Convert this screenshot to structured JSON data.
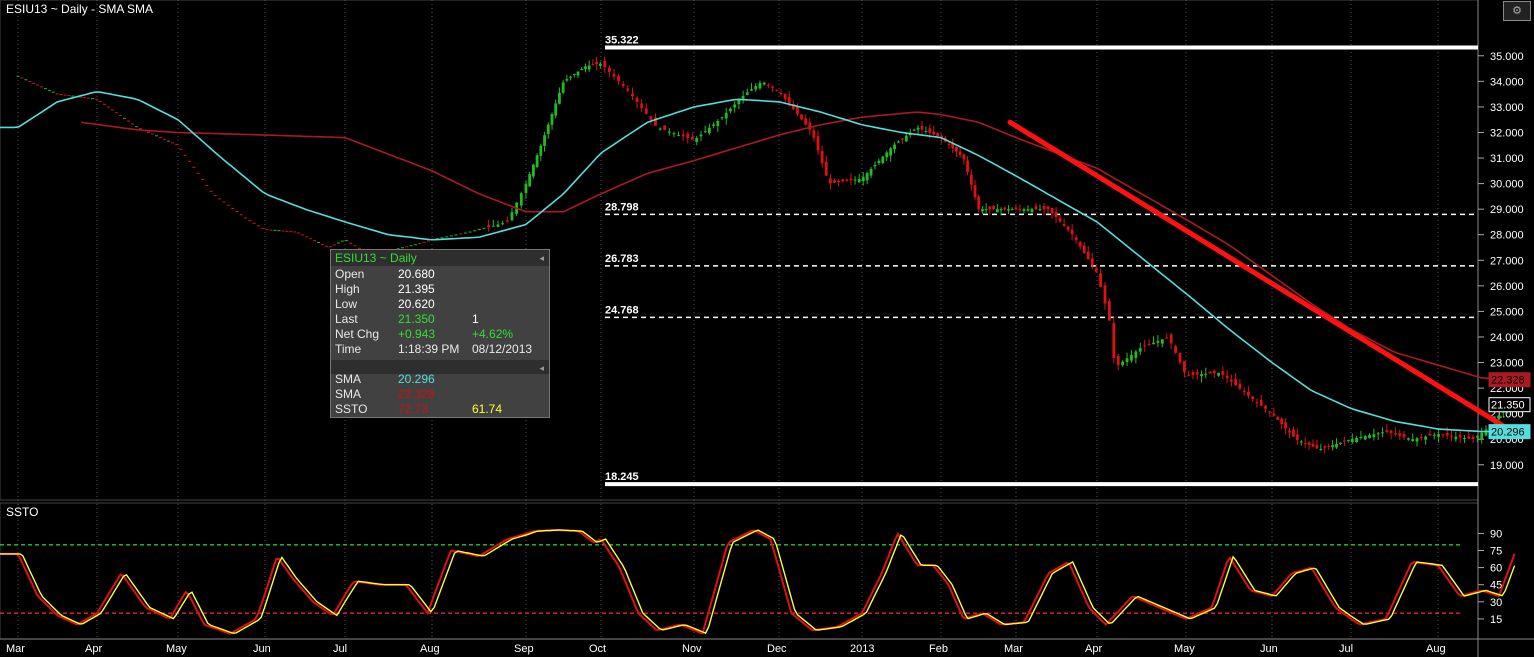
{
  "window": {
    "title": "ESIU13 ~ Daily  -  SMA SMA",
    "lower_panel_title": "SSTO",
    "settings_icon": "gear-icon"
  },
  "colors": {
    "background": "#000000",
    "up_candle": "#22bb22",
    "down_candle": "#dd1111",
    "sma_fast": "#55dddd",
    "sma_slow": "#aa1a22",
    "trendline": "#ff1111",
    "ssto_k": "#dd1111",
    "ssto_d": "#ffff33",
    "overbought_line": "#22cc22",
    "oversold_line": "#ee2222"
  },
  "info_box": {
    "title": "ESIU13 ~ Daily",
    "rows": [
      {
        "label": "Open",
        "value": "20.680",
        "value2": ""
      },
      {
        "label": "High",
        "value": "21.395",
        "value2": ""
      },
      {
        "label": "Low",
        "value": "20.620",
        "value2": ""
      },
      {
        "label": "Last",
        "value": "21.350",
        "value2": "1"
      },
      {
        "label": "Net Chg",
        "value": "+0.943",
        "value2": "+4.62%"
      },
      {
        "label": "Time",
        "value": "1:18:39 PM",
        "value2": "08/12/2013"
      }
    ],
    "indicators": [
      {
        "label": "SMA",
        "value": "20.296",
        "value2": ""
      },
      {
        "label": "SMA",
        "value": "22.328",
        "value2": ""
      },
      {
        "label": "SSTO",
        "value": "72.73",
        "value2": "61.74"
      }
    ]
  },
  "chart_data": [
    {
      "type": "candlestick",
      "title": "ESIU13 ~ Daily  -  SMA SMA",
      "x_tick_labels": [
        "Mar",
        "Apr",
        "May",
        "Jun",
        "Jul",
        "Aug",
        "Sep",
        "Oct",
        "Nov",
        "Dec",
        "2013",
        "Feb",
        "Mar",
        "Apr",
        "May",
        "Jun",
        "Jul",
        "Aug"
      ],
      "y_tick_labels": [
        "35.000",
        "34.000",
        "33.000",
        "32.000",
        "31.000",
        "30.000",
        "29.000",
        "28.000",
        "27.000",
        "26.000",
        "25.000",
        "24.000",
        "23.000",
        "22.000",
        "21.000",
        "20.000",
        "19.000"
      ],
      "ylim": [
        17.7,
        36.4
      ],
      "last_price": 21.35,
      "price_labels": [
        {
          "label": "21.350",
          "value": 21.35
        },
        {
          "label": "20.296",
          "value": 20.296
        },
        {
          "label": "22.328",
          "value": 22.328
        }
      ],
      "fib_levels": [
        {
          "label": "35.322",
          "value": 35.322,
          "style": "solid"
        },
        {
          "label": "28.798",
          "value": 28.798,
          "style": "dashed"
        },
        {
          "label": "26.783",
          "value": 26.783,
          "style": "dashed"
        },
        {
          "label": "24.768",
          "value": 24.768,
          "style": "dashed"
        },
        {
          "label": "18.245",
          "value": 18.245,
          "style": "solid"
        }
      ],
      "trendline": {
        "from_month": 11.92,
        "from_value": 32.4,
        "to_month": 17.88,
        "to_value": 20.25
      },
      "price_knots": [
        [
          0,
          34.2
        ],
        [
          0.5,
          33.5
        ],
        [
          1,
          33.3
        ],
        [
          1.5,
          32.2
        ],
        [
          2,
          31.5
        ],
        [
          2.4,
          29.6
        ],
        [
          2.8,
          28.6
        ],
        [
          3,
          28.2
        ],
        [
          3.4,
          28.1
        ],
        [
          3.8,
          27.5
        ],
        [
          4,
          27.8
        ],
        [
          4.3,
          27.2
        ],
        [
          4.8,
          27.6
        ],
        [
          5,
          27.8
        ],
        [
          5.4,
          28.1
        ],
        [
          5.8,
          28.5
        ],
        [
          6.2,
          31.5
        ],
        [
          6.5,
          34.0
        ],
        [
          6.8,
          34.6
        ],
        [
          7,
          34.7
        ],
        [
          7.3,
          33.6
        ],
        [
          7.6,
          32.2
        ],
        [
          8,
          31.7
        ],
        [
          8.3,
          32.5
        ],
        [
          8.6,
          33.5
        ],
        [
          8.8,
          34.0
        ],
        [
          9,
          33.6
        ],
        [
          9.4,
          32.0
        ],
        [
          9.6,
          30.0
        ],
        [
          10,
          30.2
        ],
        [
          10.4,
          31.5
        ],
        [
          10.7,
          32.2
        ],
        [
          11,
          31.8
        ],
        [
          11.3,
          31.0
        ],
        [
          11.5,
          29.0
        ],
        [
          11.9,
          29.0
        ],
        [
          12.4,
          29.0
        ],
        [
          12.7,
          28.0
        ],
        [
          13,
          26.5
        ],
        [
          13.15,
          24.5
        ],
        [
          13.2,
          22.8
        ],
        [
          13.5,
          23.6
        ],
        [
          13.8,
          24.0
        ],
        [
          14,
          22.5
        ],
        [
          14.4,
          22.6
        ],
        [
          14.8,
          21.5
        ],
        [
          15,
          21.0
        ],
        [
          15.3,
          20.0
        ],
        [
          15.6,
          19.6
        ],
        [
          16,
          20.0
        ],
        [
          16.4,
          20.3
        ],
        [
          16.7,
          20.0
        ],
        [
          17,
          20.2
        ],
        [
          17.4,
          20.0
        ],
        [
          17.6,
          20.5
        ],
        [
          17.8,
          21.35
        ]
      ],
      "sma_fast_knots": [
        [
          0,
          32.2
        ],
        [
          0.5,
          33.2
        ],
        [
          1,
          33.6
        ],
        [
          1.5,
          33.3
        ],
        [
          2,
          32.5
        ],
        [
          2.5,
          31.0
        ],
        [
          3,
          29.6
        ],
        [
          3.5,
          29.0
        ],
        [
          4,
          28.5
        ],
        [
          4.5,
          28.0
        ],
        [
          5,
          27.8
        ],
        [
          5.5,
          27.9
        ],
        [
          6,
          28.4
        ],
        [
          6.5,
          29.6
        ],
        [
          7,
          31.2
        ],
        [
          7.5,
          32.4
        ],
        [
          8,
          33.0
        ],
        [
          8.5,
          33.3
        ],
        [
          9,
          33.2
        ],
        [
          9.5,
          32.8
        ],
        [
          10,
          32.3
        ],
        [
          10.5,
          32.0
        ],
        [
          11,
          31.8
        ],
        [
          11.5,
          31.1
        ],
        [
          12,
          30.3
        ],
        [
          12.5,
          29.4
        ],
        [
          13,
          28.5
        ],
        [
          13.5,
          27.1
        ],
        [
          14,
          25.7
        ],
        [
          14.5,
          24.3
        ],
        [
          15,
          23.0
        ],
        [
          15.5,
          21.9
        ],
        [
          16,
          21.2
        ],
        [
          16.5,
          20.7
        ],
        [
          17,
          20.4
        ],
        [
          17.5,
          20.3
        ],
        [
          17.9,
          20.3
        ]
      ],
      "sma_slow_knots": [
        [
          0.8,
          32.4
        ],
        [
          1.5,
          32.1
        ],
        [
          2,
          32.0
        ],
        [
          3,
          31.9
        ],
        [
          4,
          31.8
        ],
        [
          5,
          30.5
        ],
        [
          5.5,
          29.6
        ],
        [
          6,
          28.9
        ],
        [
          6.5,
          28.9
        ],
        [
          7,
          29.6
        ],
        [
          7.5,
          30.4
        ],
        [
          8,
          30.9
        ],
        [
          8.5,
          31.4
        ],
        [
          9,
          31.9
        ],
        [
          9.5,
          32.3
        ],
        [
          10,
          32.6
        ],
        [
          10.7,
          32.8
        ],
        [
          11,
          32.7
        ],
        [
          11.5,
          32.4
        ],
        [
          12,
          31.8
        ],
        [
          12.5,
          31.2
        ],
        [
          13,
          30.6
        ],
        [
          13.5,
          29.6
        ],
        [
          14,
          28.6
        ],
        [
          14.5,
          27.6
        ],
        [
          15,
          26.4
        ],
        [
          15.5,
          25.3
        ],
        [
          16,
          24.3
        ],
        [
          16.5,
          23.4
        ],
        [
          17,
          22.9
        ],
        [
          17.5,
          22.4
        ],
        [
          17.9,
          22.3
        ]
      ]
    },
    {
      "type": "line",
      "title": "SSTO",
      "y_tick_labels": [
        "90",
        "75",
        "60",
        "45",
        "30",
        "15"
      ],
      "ylim": [
        0,
        100
      ],
      "overbought": 80,
      "oversold": 20,
      "series": [
        {
          "name": "SSTO",
          "last": 72.73
        },
        {
          "name": "SSTO",
          "last": 61.74
        }
      ],
      "ssto_knots": [
        [
          0,
          72
        ],
        [
          0.25,
          35
        ],
        [
          0.5,
          18
        ],
        [
          0.75,
          10
        ],
        [
          1,
          20
        ],
        [
          1.3,
          55
        ],
        [
          1.6,
          25
        ],
        [
          1.9,
          15
        ],
        [
          2.1,
          40
        ],
        [
          2.3,
          10
        ],
        [
          2.6,
          2
        ],
        [
          2.9,
          15
        ],
        [
          3.15,
          70
        ],
        [
          3.35,
          50
        ],
        [
          3.6,
          30
        ],
        [
          3.85,
          18
        ],
        [
          4.1,
          48
        ],
        [
          4.4,
          45
        ],
        [
          4.7,
          45
        ],
        [
          4.95,
          20
        ],
        [
          5.2,
          75
        ],
        [
          5.5,
          70
        ],
        [
          5.8,
          85
        ],
        [
          6.1,
          92
        ],
        [
          6.4,
          93
        ],
        [
          6.7,
          92
        ],
        [
          6.9,
          82
        ],
        [
          7,
          85
        ],
        [
          7.2,
          60
        ],
        [
          7.4,
          20
        ],
        [
          7.6,
          5
        ],
        [
          7.85,
          10
        ],
        [
          8.1,
          2
        ],
        [
          8.4,
          82
        ],
        [
          8.7,
          93
        ],
        [
          8.9,
          85
        ],
        [
          9.15,
          20
        ],
        [
          9.4,
          5
        ],
        [
          9.7,
          8
        ],
        [
          10,
          20
        ],
        [
          10.25,
          55
        ],
        [
          10.45,
          90
        ],
        [
          10.7,
          62
        ],
        [
          10.9,
          62
        ],
        [
          11.1,
          45
        ],
        [
          11.3,
          15
        ],
        [
          11.55,
          20
        ],
        [
          11.8,
          10
        ],
        [
          12.1,
          12
        ],
        [
          12.4,
          55
        ],
        [
          12.65,
          65
        ],
        [
          12.9,
          25
        ],
        [
          13.1,
          10
        ],
        [
          13.4,
          35
        ],
        [
          13.7,
          25
        ],
        [
          14,
          15
        ],
        [
          14.3,
          25
        ],
        [
          14.5,
          70
        ],
        [
          14.75,
          40
        ],
        [
          15,
          35
        ],
        [
          15.25,
          55
        ],
        [
          15.5,
          60
        ],
        [
          15.8,
          25
        ],
        [
          16.1,
          10
        ],
        [
          16.4,
          15
        ],
        [
          16.7,
          65
        ],
        [
          17,
          62
        ],
        [
          17.25,
          35
        ],
        [
          17.5,
          40
        ],
        [
          17.7,
          35
        ],
        [
          17.88,
          72
        ]
      ]
    }
  ]
}
